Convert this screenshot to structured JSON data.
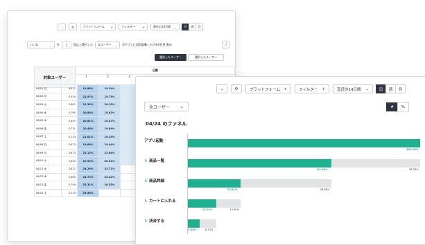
{
  "back": {
    "toolbar": {
      "platform": "プラットフォーム",
      "filter": "フィルター",
      "range": "直近の14日間",
      "seg": [
        "日",
        "週",
        "月"
      ]
    },
    "controls": {
      "event": "いいね",
      "op": "を",
      "count": "1",
      "text1": "回以上実行した",
      "segment": "全ユーザー",
      "text2": "がアプリに初回起動した日を0日目 表示",
      "btn_selected": "選択したユーザー",
      "btn_unselected": "選択したユーザー"
    },
    "table": {
      "header_users": "対象ユーザー",
      "header_day": "日数",
      "day_cols": [
        "1",
        "2",
        "3"
      ],
      "rows": [
        {
          "date": "06/01 日",
          "count": "6,812",
          "p1": "19.88%",
          "p2": "19.29%"
        },
        {
          "date": "06/02 月",
          "count": "5,924",
          "p1": "22.97%",
          "p2": "19.75%"
        },
        {
          "date": "06/03 火",
          "count": "5,801",
          "p1": "21.35%",
          "p2": "20.15%"
        },
        {
          "date": "06/04 水",
          "count": "5,765",
          "p1": "20.88%",
          "p2": "19.62%"
        },
        {
          "date": "06/05 木",
          "count": "5,647",
          "p1": "20.61%",
          "p2": "19.47%"
        },
        {
          "date": "06/06 金",
          "count": "5,731",
          "p1": "20.46%",
          "p2": "19.89%"
        },
        {
          "date": "06/07 土",
          "count": "5,733",
          "p1": "21.01%",
          "p2": "19.25%"
        },
        {
          "date": "06/08 日",
          "count": "5,873",
          "p1": "19.68%",
          "p2": "19.44%"
        },
        {
          "date": "06/09 月",
          "count": "5,673",
          "p1": "22.12%",
          "p2": "22.64%"
        },
        {
          "date": "06/10 火",
          "count": "5,625",
          "p1": "20.93%",
          "p2": "20.32%"
        },
        {
          "date": "06/11 水",
          "count": "5,611",
          "p1": "24.29%",
          "p2": "23.71%"
        },
        {
          "date": "06/12 木",
          "count": "5,600",
          "p1": "24.72%",
          "p2": "22.42%"
        },
        {
          "date": "06/13 金",
          "count": "5,794",
          "p1": "25.31%",
          "p2": "20.55%"
        },
        {
          "date": "06/14 土",
          "count": "5,072",
          "p1": "23.56%",
          "p2": ""
        }
      ]
    }
  },
  "front": {
    "toolbar": {
      "platform": "プラットフォーム",
      "filter": "フィルター",
      "range": "直近の14日間",
      "seg": [
        "日",
        "週",
        "月"
      ]
    },
    "segment_select": "全ユーザー",
    "toggle": [
      "#",
      "%"
    ],
    "title": "04/24 のファネル",
    "funnel": [
      {
        "label": "アプリ起動",
        "pct_fill": 100.0,
        "pct_text": "100.00%",
        "track": 100.0,
        "track_text": ""
      },
      {
        "label": "商品一覧",
        "pct_fill": 61.69,
        "pct_text": "61.69%",
        "track": 100.0,
        "track_text": "38.32%"
      },
      {
        "label": "商品詳細",
        "pct_fill": 22.81,
        "pct_text": "22.81%",
        "track": 61.69,
        "track_text": "38.88%"
      },
      {
        "label": "カートに入れる",
        "pct_fill": 12.21,
        "pct_text": "12.21%",
        "track": 22.81,
        "track_text": "10.60%"
      },
      {
        "label": "決済する",
        "pct_fill": 5.08,
        "pct_text": "5.08%",
        "track": 12.21,
        "track_text": "8.13%"
      }
    ]
  }
}
